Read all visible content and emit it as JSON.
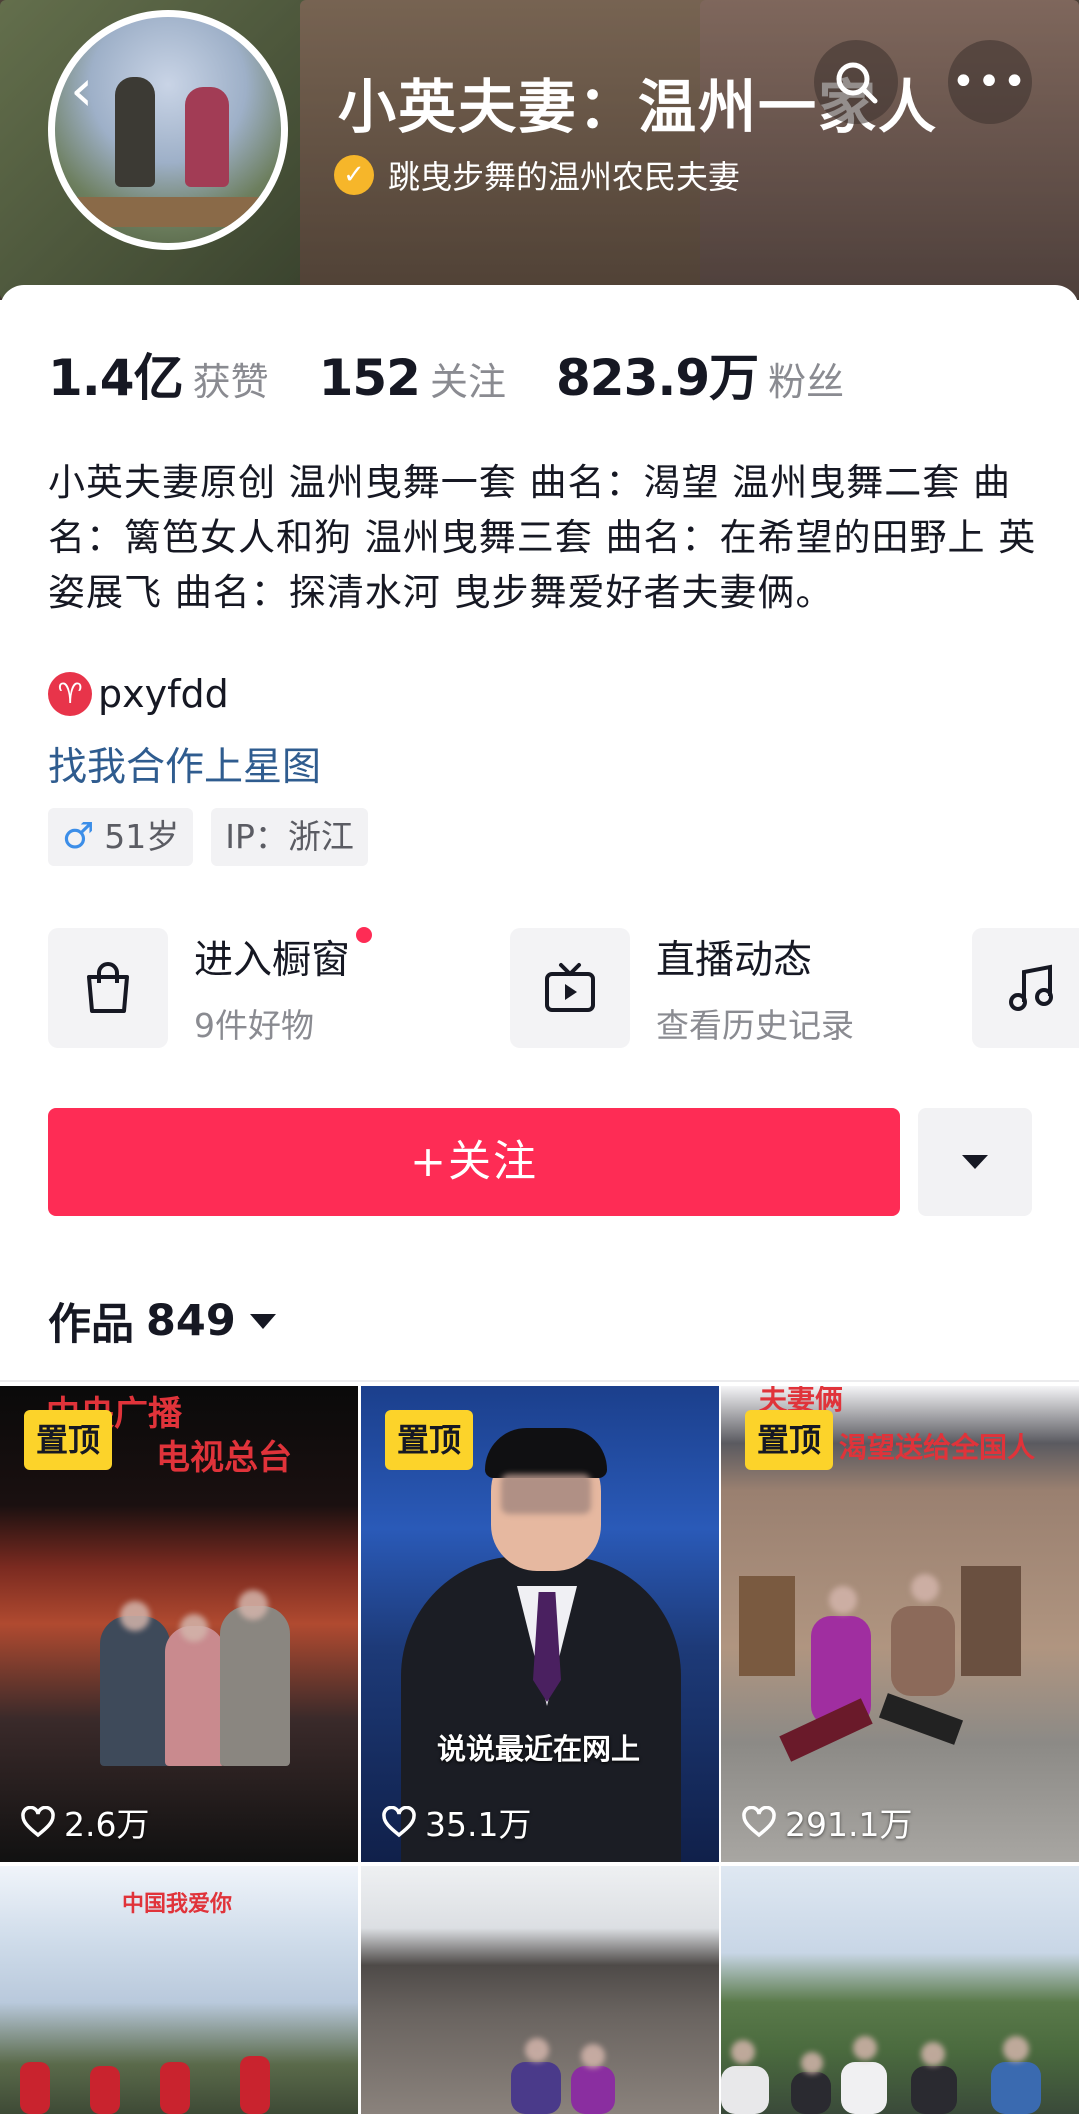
{
  "profile": {
    "name": "小英夫妻：温州一家人",
    "verified_text": "跳曳步舞的温州农民夫妻",
    "stats": [
      {
        "value": "1.4亿",
        "label": "获赞"
      },
      {
        "value": "152",
        "label": "关注"
      },
      {
        "value": "823.9万",
        "label": "粉丝"
      }
    ],
    "bio": "小英夫妻原创  温州曳舞一套  曲名：渴望   温州曳舞二套  曲名：篱笆女人和狗  温州曳舞三套   曲名：在希望的田野上   英姿展飞   曲名：探清水河  曳步舞爱好者夫妻俩。",
    "handle": "pxyfdd",
    "xingtu_link": "找我合作上星图",
    "tags": [
      "51岁",
      "IP：浙江"
    ]
  },
  "entries": [
    {
      "title": "进入橱窗",
      "subtitle": "9件好物",
      "icon": "shopping-bag-icon",
      "has_dot": true
    },
    {
      "title": "直播动态",
      "subtitle": "查看历史记录",
      "icon": "tv-icon",
      "has_dot": false
    },
    {
      "title": "",
      "subtitle": "",
      "icon": "music-note-icon"
    }
  ],
  "actions": {
    "follow_label": "+关注"
  },
  "works": {
    "label": "作品",
    "count": "849"
  },
  "videos": [
    {
      "pinned": true,
      "pin_label": "置顶",
      "likes": "2.6万",
      "overlay_lines": [
        "中央广播",
        "电视总台"
      ]
    },
    {
      "pinned": true,
      "pin_label": "置顶",
      "likes": "35.1万",
      "overlay_lines": [
        "说说最近在网上"
      ]
    },
    {
      "pinned": true,
      "pin_label": "置顶",
      "likes": "291.1万",
      "overlay_lines": [
        "夫妻俩",
        "渴望送给全国人"
      ]
    },
    {
      "pinned": false,
      "likes": "",
      "overlay_lines": [
        "中国我爱你"
      ]
    },
    {
      "pinned": false,
      "likes": "",
      "overlay_lines": []
    },
    {
      "pinned": false,
      "likes": "",
      "overlay_lines": []
    }
  ],
  "colors": {
    "accent": "#fe2c55",
    "pin": "#fcd32a",
    "link": "#2f5c8f",
    "verified": "#f6b62a"
  }
}
